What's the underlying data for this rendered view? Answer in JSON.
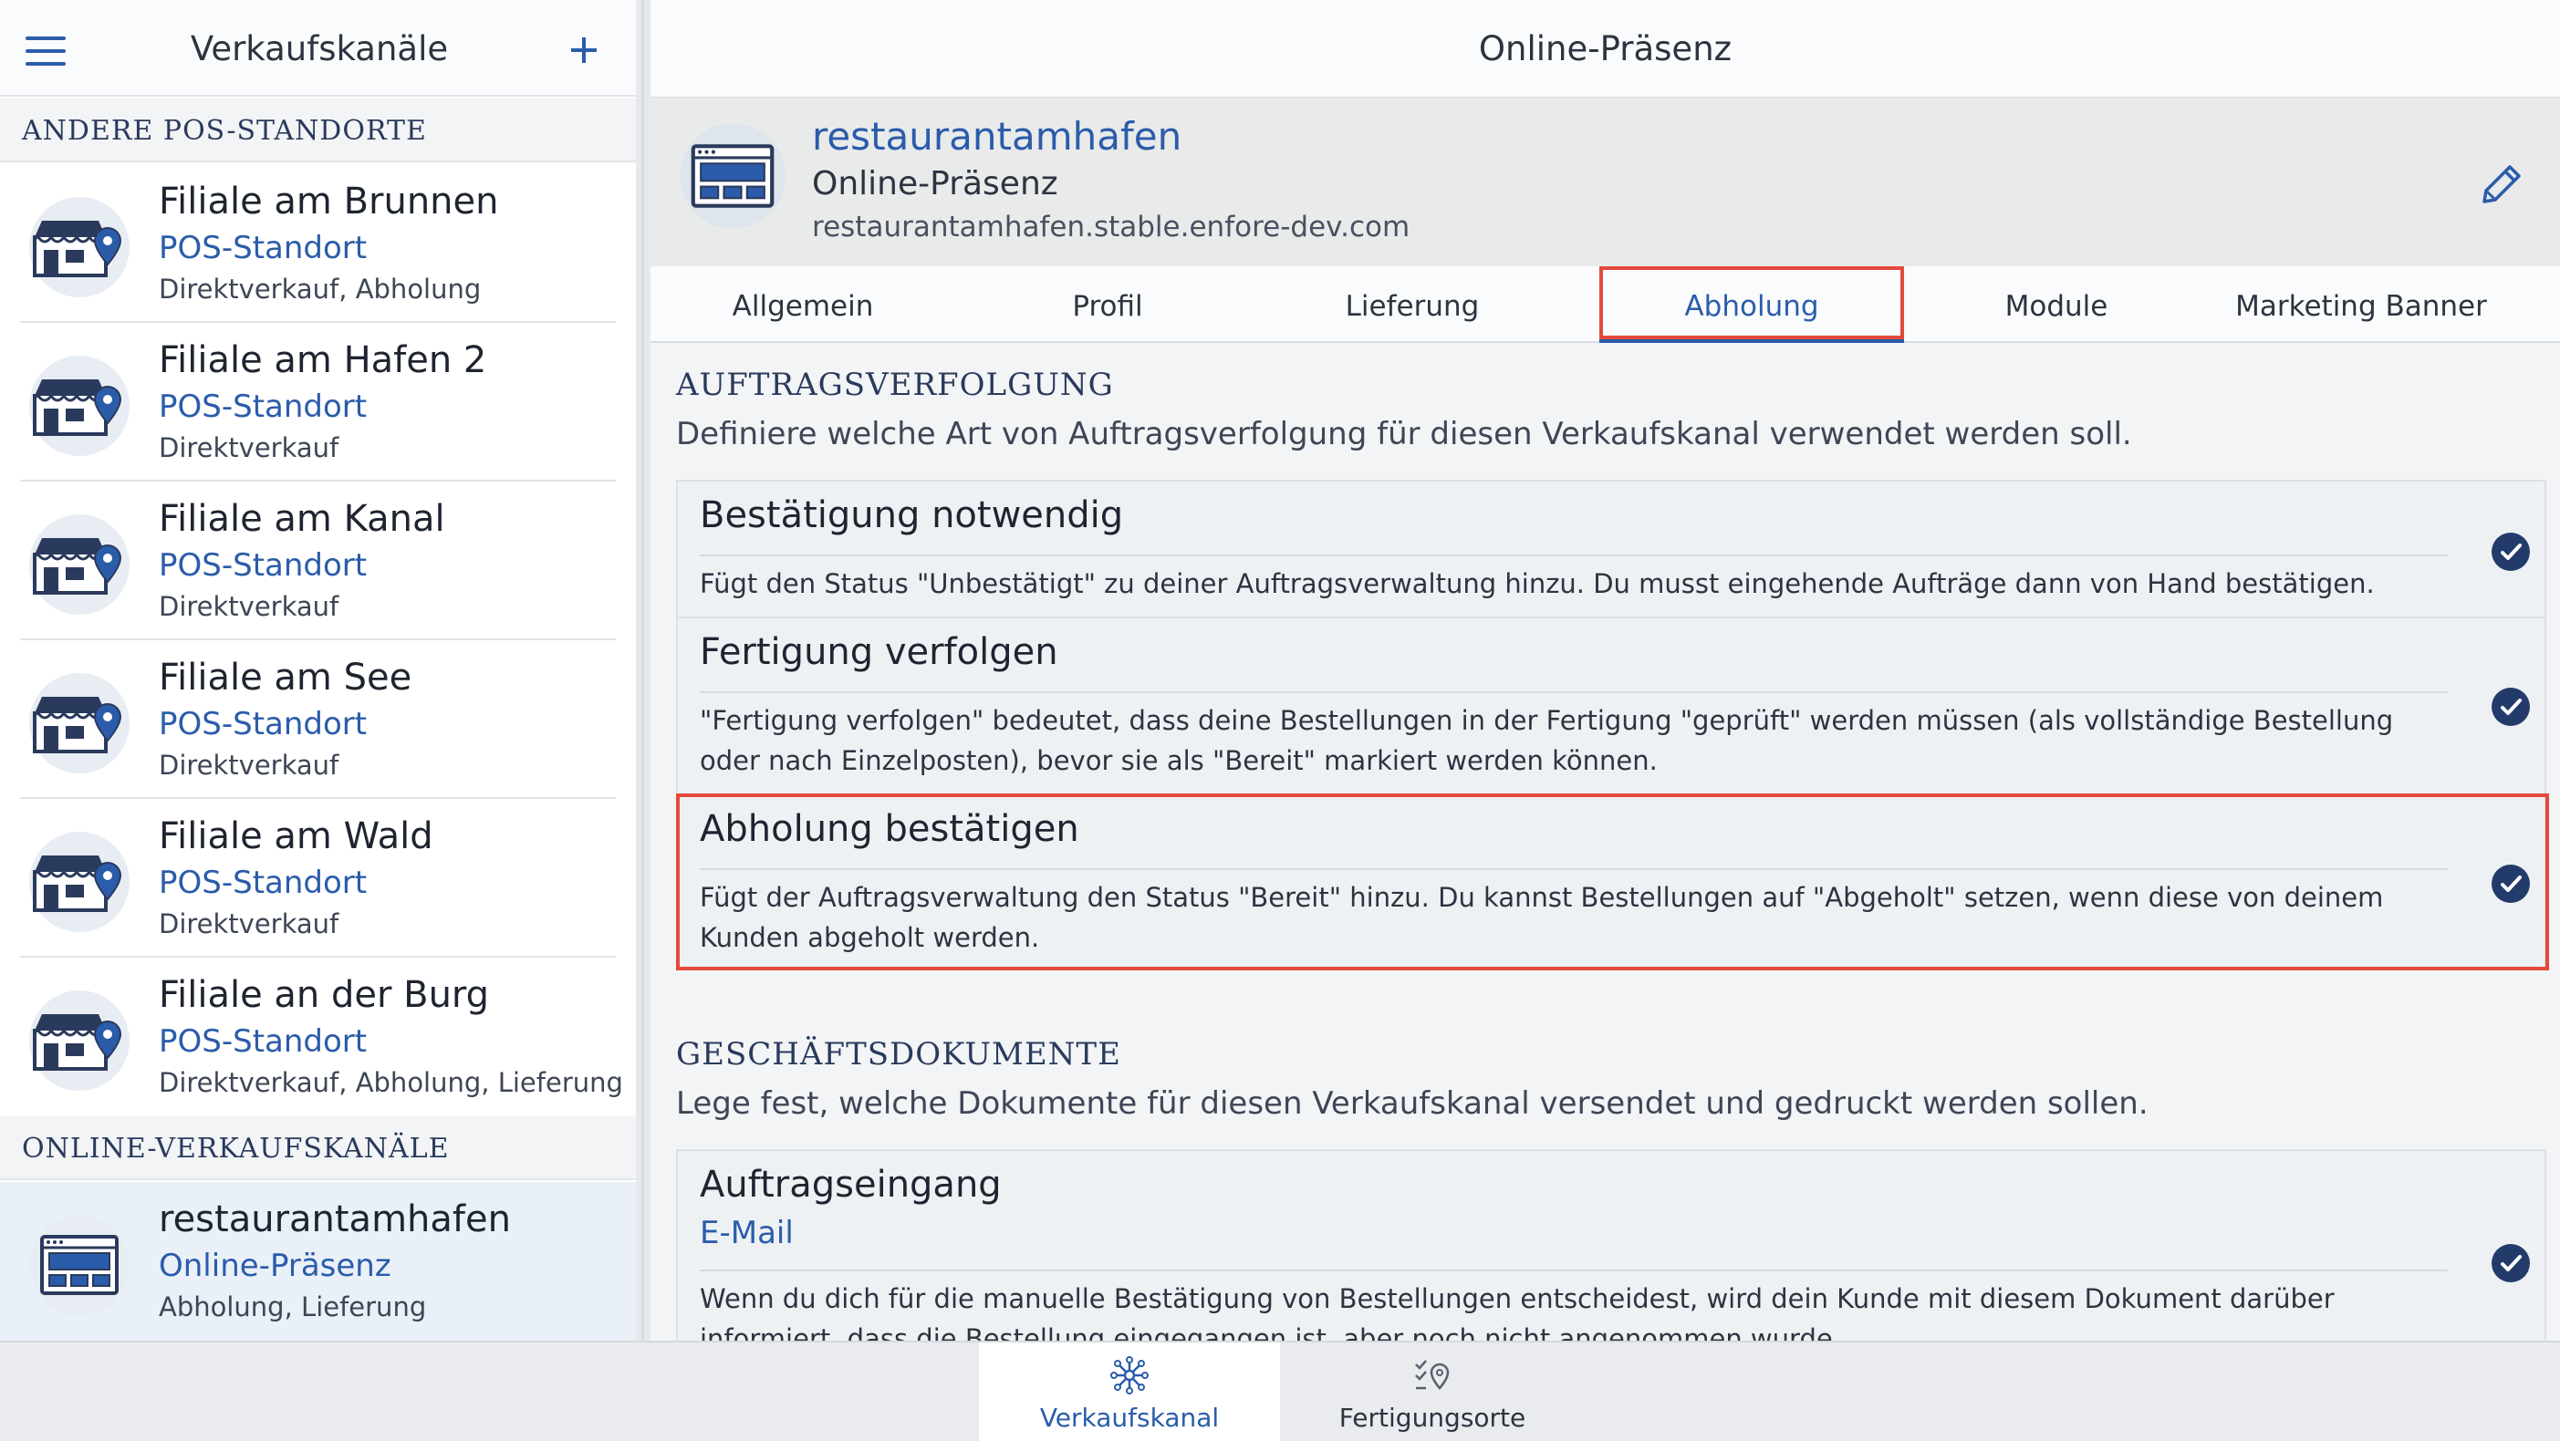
{
  "sidebar": {
    "title": "Verkaufskanäle",
    "section_pos": "ANDERE POS-STANDORTE",
    "section_online": "ONLINE-VERKAUFSKANÄLE",
    "locations": [
      {
        "name": "Filiale am Brunnen",
        "type": "POS-Standort",
        "modes": "Direktverkauf, Abholung"
      },
      {
        "name": "Filiale am Hafen 2",
        "type": "POS-Standort",
        "modes": "Direktverkauf"
      },
      {
        "name": "Filiale am Kanal",
        "type": "POS-Standort",
        "modes": "Direktverkauf"
      },
      {
        "name": "Filiale am See",
        "type": "POS-Standort",
        "modes": "Direktverkauf"
      },
      {
        "name": "Filiale am Wald",
        "type": "POS-Standort",
        "modes": "Direktverkauf"
      },
      {
        "name": "Filiale an der Burg",
        "type": "POS-Standort",
        "modes": "Direktverkauf, Abholung, Lieferung"
      }
    ],
    "online": [
      {
        "name": "restaurantamhafen",
        "type": "Online-Präsenz",
        "modes": "Abholung, Lieferung"
      }
    ]
  },
  "main": {
    "title": "Online-Präsenz",
    "channel": {
      "name": "restaurantamhafen",
      "type": "Online-Präsenz",
      "url": "restaurantamhafen.stable.enfore-dev.com"
    },
    "tabs": [
      "Allgemein",
      "Profil",
      "Lieferung",
      "Abholung",
      "Module",
      "Marketing Banner"
    ],
    "active_tab": "Abholung",
    "tracking": {
      "title": "AUFTRAGSVERFOLGUNG",
      "description": "Definiere welche Art von Auftragsverfolgung für diesen Verkaufskanal verwendet werden soll.",
      "options": [
        {
          "label": "Bestätigung notwendig",
          "desc": "Fügt den Status \"Unbestätigt\" zu deiner Auftragsverwaltung hinzu. Du musst eingehende Aufträge dann von Hand bestätigen.",
          "checked": true
        },
        {
          "label": "Fertigung verfolgen",
          "desc": "\"Fertigung verfolgen\" bedeutet, dass deine Bestellungen in der Fertigung \"geprüft\" werden müssen (als vollständige Bestellung oder nach Einzelposten), bevor sie als \"Bereit\" markiert werden können.",
          "checked": true
        },
        {
          "label": "Abholung bestätigen",
          "desc": "Fügt der Auftragsverwaltung den Status \"Bereit\" hinzu. Du kannst Bestellungen auf \"Abgeholt\" setzen, wenn diese von deinem Kunden abgeholt werden.",
          "checked": true
        }
      ]
    },
    "documents": {
      "title": "GESCHÄFTSDOKUMENTE",
      "description": "Lege fest, welche Dokumente für diesen Verkaufskanal versendet und gedruckt werden sollen.",
      "options": [
        {
          "label": "Auftragseingang",
          "sub": "E-Mail",
          "desc": "Wenn du dich für die manuelle Bestätigung von Bestellungen entscheidest, wird dein Kunde mit diesem Dokument darüber informiert, dass die Bestellung eingegangen ist, aber noch nicht angenommen wurde.",
          "checked": true
        }
      ]
    }
  },
  "bottom_nav": {
    "items": [
      "Verkaufskanal",
      "Fertigungsorte"
    ],
    "active": "Verkaufskanal"
  },
  "colors": {
    "accent": "#2a5caa",
    "check": "#233b6b",
    "highlight": "#e34a3b"
  }
}
